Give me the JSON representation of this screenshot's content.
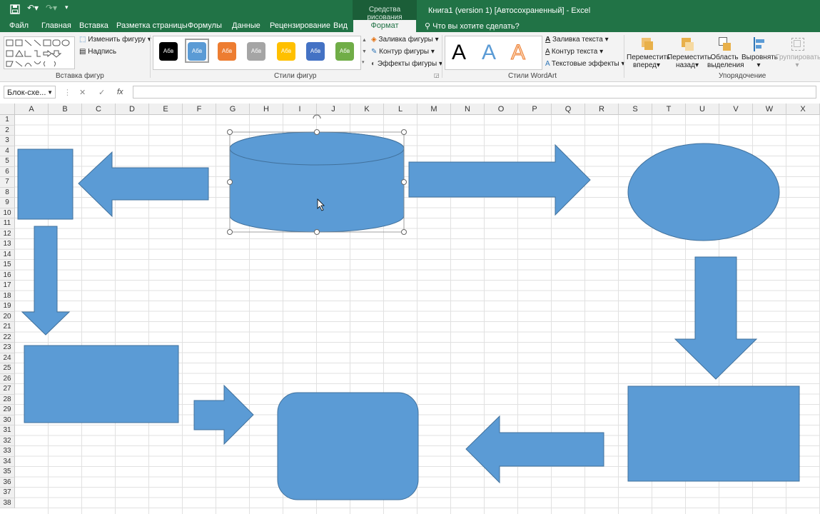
{
  "title_bar": {
    "context_tab": "Средства рисования",
    "title": "Книга1 (version 1) [Автосохраненный] - Excel"
  },
  "tabs": [
    "Файл",
    "Главная",
    "Вставка",
    "Разметка страницы",
    "Формулы",
    "Данные",
    "Рецензирование",
    "Вид"
  ],
  "active_tab": "Формат",
  "tell_me": "Что вы хотите сделать?",
  "ribbon": {
    "insert_shapes": {
      "edit_shape": "Изменить фигуру",
      "text_box": "Надпись",
      "label": "Вставка фигур"
    },
    "shape_styles": {
      "swatch_text": "Абв",
      "swatch_colors": [
        "#000000",
        "#5b9bd5",
        "#ed7d31",
        "#a5a5a5",
        "#ffc000",
        "#4472c4",
        "#70ad47"
      ],
      "fill": "Заливка фигуры",
      "outline": "Контур фигуры",
      "effects": "Эффекты фигуры",
      "label": "Стили фигур"
    },
    "wordart": {
      "letter": "A",
      "text_fill": "Заливка текста",
      "text_outline": "Контур текста",
      "text_effects": "Текстовые эффекты",
      "label": "Стили WordArt"
    },
    "arrange": {
      "bring_forward_1": "Переместить",
      "bring_forward_2": "вперед",
      "send_backward_1": "Переместить",
      "send_backward_2": "назад",
      "selection_pane_1": "Область",
      "selection_pane_2": "выделения",
      "align": "Выровнять",
      "group": "Группировать",
      "label": "Упорядочение"
    }
  },
  "formula_bar": {
    "name_box": "Блок-схе...",
    "cancel": "✕",
    "enter": "✓",
    "fx": "fx",
    "formula": ""
  },
  "columns": [
    "A",
    "B",
    "C",
    "D",
    "E",
    "F",
    "G",
    "H",
    "I",
    "J",
    "K",
    "L",
    "M",
    "N",
    "O",
    "P",
    "Q",
    "R",
    "S",
    "T",
    "U",
    "V",
    "W",
    "X"
  ],
  "rows": [
    "1",
    "2",
    "3",
    "4",
    "5",
    "6",
    "7",
    "8",
    "9",
    "10",
    "11",
    "12",
    "13",
    "14",
    "15",
    "16",
    "17",
    "18",
    "19",
    "20",
    "21",
    "22",
    "23",
    "24",
    "25",
    "26",
    "27",
    "28",
    "29",
    "30",
    "31",
    "32",
    "33",
    "34",
    "35",
    "36",
    "37",
    "38"
  ],
  "colors": {
    "accent": "#217346",
    "shape_fill": "#5b9bd5",
    "shape_stroke": "#41719c"
  }
}
